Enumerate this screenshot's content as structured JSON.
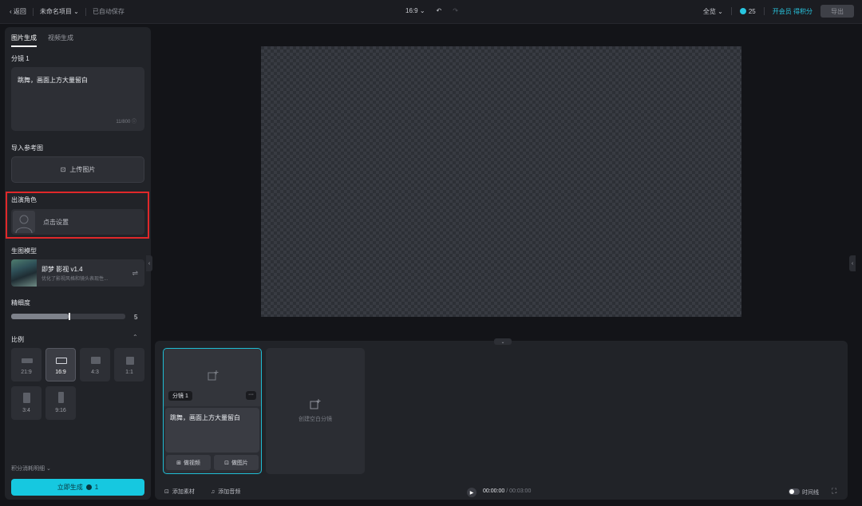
{
  "topbar": {
    "back_label": "返回",
    "project_name": "未命名项目",
    "save_status": "已自动保存",
    "aspect": "16:9",
    "undo_icon": "undo-icon",
    "redo_icon": "redo-icon",
    "zoom": "全览",
    "credits": "25",
    "vip_label": "开会员 得积分",
    "export_label": "导出"
  },
  "left": {
    "tabs": [
      "图片生成",
      "视频生成"
    ],
    "shot_label": "分镜 1",
    "prompt_text": "跳舞，画面上方大量留白",
    "prompt_count": "11/800",
    "ref_label": "导入参考图",
    "upload_label": "上传图片",
    "role_label": "出演角色",
    "role_action": "点击设置",
    "model_section": "生图模型",
    "model_name": "即梦 影视 v1.4",
    "model_desc": "优化了影视风格和镜头表现性...",
    "fineness_label": "精细度",
    "fineness_value": "5",
    "fineness_fraction": 0.5,
    "ratio_label": "比例",
    "ratios": [
      "21:9",
      "16:9",
      "4:3",
      "1:1",
      "3:4",
      "9:16"
    ],
    "selected_ratio": "16:9",
    "cost_label": "积分消耗明细",
    "generate_label": "立即生成",
    "generate_cost": "1"
  },
  "timeline": {
    "shot_badge": "分镜 1",
    "shot_text": "跳舞，画面上方大量留白",
    "btn_video": "做视频",
    "btn_image": "做图片",
    "empty_label": "创建空白分镜",
    "add_material": "添加素材",
    "add_audio": "添加音频",
    "time_current": "00:00:00",
    "time_total": "00:03:00",
    "timeline_label": "时间线"
  },
  "colors": {
    "accent": "#16c8e0",
    "highlight_box": "#e0282a"
  }
}
